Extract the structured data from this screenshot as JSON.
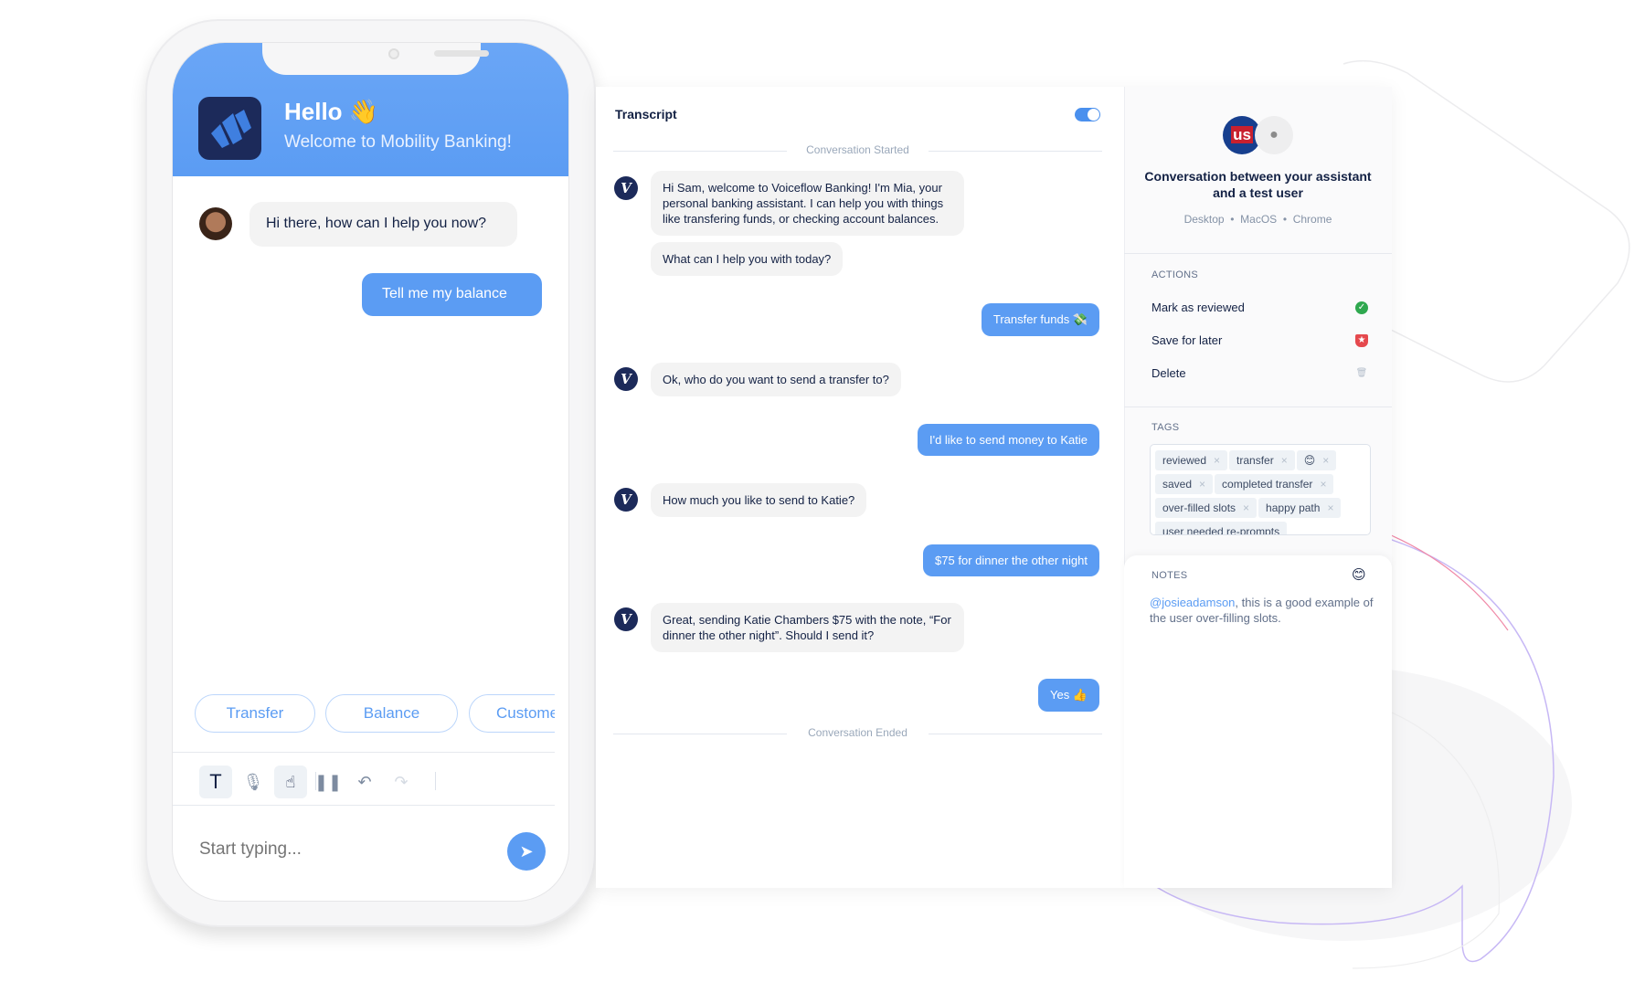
{
  "phone": {
    "header": {
      "title": "Hello",
      "title_emoji": "👋",
      "subtitle": "Welcome to Mobility Banking!"
    },
    "messages": [
      {
        "sender": "bot",
        "text": "Hi there, how can I help you now?"
      },
      {
        "sender": "user",
        "text": "Tell me my  balance"
      }
    ],
    "quick_replies": [
      "Transfer",
      "Balance",
      "Customer"
    ],
    "toolbar": {
      "text_mode": "T"
    },
    "input": {
      "placeholder": "Start typing..."
    },
    "colors": {
      "accent": "#5b9cf3",
      "logo_bg": "#1c2a5a"
    }
  },
  "transcript": {
    "title": "Transcript",
    "started_label": "Conversation Started",
    "ended_label": "Conversation Ended",
    "bot_avatar_letter": "V",
    "messages": [
      {
        "sender": "bot",
        "text": "Hi Sam, welcome to Voiceflow Banking! I'm Mia, your personal banking assistant. I can help you with things like transfering funds, or checking account balances."
      },
      {
        "sender": "bot",
        "text": "What can I help you with today?"
      },
      {
        "sender": "user",
        "text": "Transfer funds 💸"
      },
      {
        "sender": "bot",
        "text": "Ok, who do you want to send a transfer to?"
      },
      {
        "sender": "user",
        "text": "I'd like to send money to Katie"
      },
      {
        "sender": "bot",
        "text": "How much you like to send to Katie?"
      },
      {
        "sender": "user",
        "text": "$75 for dinner the other night"
      },
      {
        "sender": "bot",
        "text": "Great, sending Katie Chambers $75 with the note, “For dinner the other night”. Should I send it?"
      },
      {
        "sender": "user",
        "text": "Yes 👍"
      }
    ]
  },
  "details": {
    "avatar_logo_text": "us",
    "title": "Conversation between your assistant and a test user",
    "meta": [
      "Desktop",
      "MacOS",
      "Chrome"
    ],
    "actions_label": "ACTIONS",
    "actions": [
      {
        "label": "Mark as reviewed",
        "icon": "check-circle-icon",
        "color": "#2fa84f"
      },
      {
        "label": "Save for later",
        "icon": "bookmark-star-icon",
        "color": "#e5484d"
      },
      {
        "label": "Delete",
        "icon": "trash-icon",
        "color": "#b5bfcc"
      }
    ],
    "tags_label": "TAGS",
    "tags": [
      "reviewed",
      "transfer",
      "😊",
      "saved",
      "completed transfer",
      "over-filled slots",
      "happy path",
      "user needed re-prompts"
    ],
    "notes_label": "NOTES",
    "notes_emoji": "😊",
    "note_mention": "@josieadamson",
    "note_text": ", this is a good example of the user over-filling slots."
  }
}
